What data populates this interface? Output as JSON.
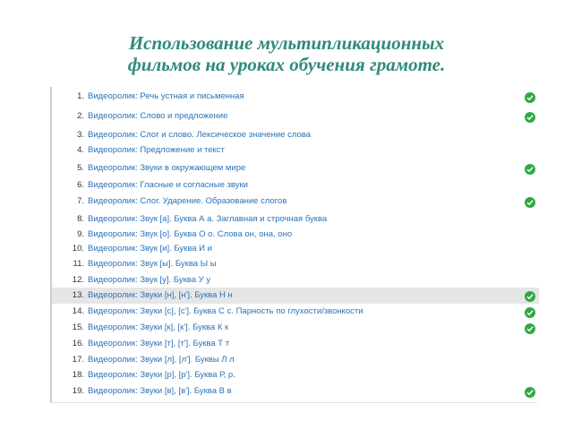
{
  "title": {
    "line1": "Использование мультипликационных",
    "line2": "фильмов на уроках обучения грамоте."
  },
  "colors": {
    "title": "#2e8b7a",
    "link": "#2a72b8",
    "check": "#2eaa3f",
    "highlight": "#e6e6e6"
  },
  "items": [
    {
      "num": "1.",
      "label": "Видеоролик: Речь устная и письменная",
      "done": true
    },
    {
      "num": "2.",
      "label": "Видеоролик: Слово и предложение",
      "done": true
    },
    {
      "num": "3.",
      "label": "Видеоролик: Слог и слово. Лексическое значение слова",
      "done": false
    },
    {
      "num": "4.",
      "label": "Видеоролик: Предложение и текст",
      "done": false
    },
    {
      "num": "5.",
      "label": "Видеоролик: Звуки в окружающем мире",
      "done": true
    },
    {
      "num": "6.",
      "label": "Видеоролик: Гласные и согласные звуки",
      "done": false
    },
    {
      "num": "7.",
      "label": "Видеоролик: Слог. Ударение. Образование слогов",
      "done": true
    },
    {
      "num": "8.",
      "label": "Видеоролик: Звук [а]. Буква А а. Заглавная и строчная буква",
      "done": false
    },
    {
      "num": "9.",
      "label": "Видеоролик: Звук [о]. Буква О о. Слова он, она, оно",
      "done": false
    },
    {
      "num": "10.",
      "label": "Видеоролик: Звук [и]. Буква И и",
      "done": false
    },
    {
      "num": "11.",
      "label": "Видеоролик: Звук [ы]. Буква Ы ы",
      "done": false
    },
    {
      "num": "12.",
      "label": "Видеоролик: Звук [у]. Буква У у",
      "done": false
    },
    {
      "num": "13.",
      "label": "Видеоролик: Звуки [н], [н']. Буква Н н",
      "done": true,
      "highlighted": true
    },
    {
      "num": "14.",
      "label": "Видеоролик: Звуки [с], [с']. Буква С с. Парность по глухости/звонкости",
      "done": true
    },
    {
      "num": "15.",
      "label": "Видеоролик: Звуки [к], [к']. Буква К к",
      "done": true
    },
    {
      "num": "16.",
      "label": "Видеоролик: Звуки [т], [т']. Буква Т т",
      "done": false
    },
    {
      "num": "17.",
      "label": "Видеоролик: Звуки [л], [л']. Буквы Л л",
      "done": false
    },
    {
      "num": "18.",
      "label": "Видеоролик: Звуки [р], [р']. Буква Р, р.",
      "done": false
    },
    {
      "num": "19.",
      "label": "Видеоролик: Звуки [в], [в']. Буква В в",
      "done": true
    }
  ]
}
